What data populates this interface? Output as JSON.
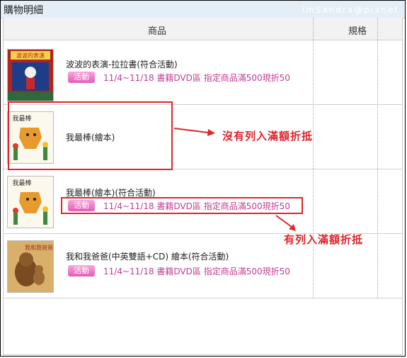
{
  "panel": {
    "title": "購物明細",
    "watermark": "imSandra@pixnet"
  },
  "table": {
    "col_product": "商品",
    "col_spec": "規格"
  },
  "rows": [
    {
      "name": "波波的表演-拉拉書(符合活動)",
      "badge": "活動",
      "promo": "11/4~11/18 書籍DVD區 指定商品滿500現折50",
      "cover_text": "波波的表演"
    },
    {
      "name": "我最棒(繪本)",
      "cover_text": "我最棒"
    },
    {
      "name": "我最棒(繪本)(符合活動)",
      "badge": "活動",
      "promo": "11/4~11/18 書籍DVD區 指定商品滿500現折50",
      "cover_text": "我最棒"
    },
    {
      "name": "我和我爸爸(中英雙語+CD) 繪本(符合活動)",
      "badge": "活動",
      "promo": "11/4~11/18 書籍DVD區 指定商品滿500現折50",
      "cover_text": "我和我爸爸"
    }
  ],
  "annotations": {
    "not_included": "沒有列入滿額折抵",
    "included": "有列入滿額折抵"
  },
  "colors": {
    "annotation_red": "#e0242b",
    "badge_pink": "#e55bb8",
    "promo_text": "#c23c95",
    "title_bar": "#e3eef6"
  }
}
